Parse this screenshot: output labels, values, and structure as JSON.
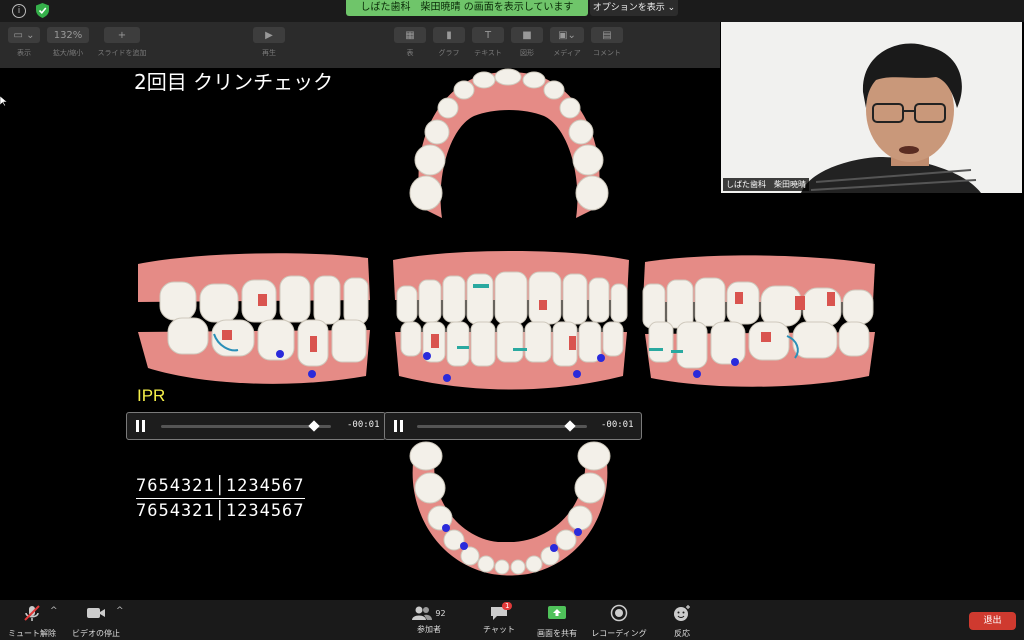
{
  "banner": {
    "share_text": "しばた歯科　柴田暁晴 の画面を表示しています",
    "options_label": "オプションを表示 ⌄"
  },
  "toolbar": {
    "view_label": "表示",
    "zoom_value": "132%",
    "zoom_label": "拡大/縮小",
    "add_slide_label": "スライドを追加",
    "play_label": "再生",
    "table_label": "表",
    "chart_label": "グラフ",
    "text_label": "テキスト",
    "shape_label": "図形",
    "media_label": "メディア",
    "comment_label": "コメント"
  },
  "slide": {
    "title": "2回目 クリンチェック",
    "ipr_label": "IPR",
    "players": [
      {
        "time": "-00:01",
        "progress": 0.9
      },
      {
        "time": "-00:01",
        "progress": 0.9
      }
    ],
    "numbers_top": "7654321│1234567",
    "numbers_bottom": "7654321│1234567"
  },
  "video": {
    "participant_name": "しばた歯科　柴田暁晴"
  },
  "meeting": {
    "mute_label": "ミュート解除",
    "video_label": "ビデオの停止",
    "participants_label": "参加者",
    "participants_count": "92",
    "chat_label": "チャット",
    "chat_badge": "1",
    "share_label": "画面を共有",
    "record_label": "レコーディング",
    "reactions_label": "反応",
    "leave_label": "退出"
  },
  "colors": {
    "share_green": "#6fc56a",
    "leave_red": "#cf3a2f",
    "ipr_yellow": "#f5ef4a",
    "dot_blue": "#2a2adb"
  }
}
